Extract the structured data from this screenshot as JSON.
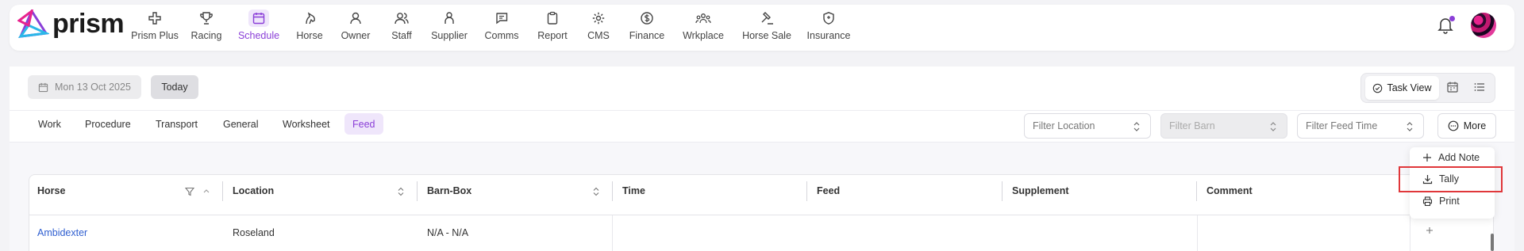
{
  "brand": {
    "name": "prism"
  },
  "nav": {
    "items": [
      {
        "label": "Prism Plus",
        "icon": "hospital-cross-icon"
      },
      {
        "label": "Racing",
        "icon": "trophy-icon"
      },
      {
        "label": "Schedule",
        "icon": "calendar-icon",
        "active": true
      },
      {
        "label": "Horse",
        "icon": "horse-icon"
      },
      {
        "label": "Owner",
        "icon": "user-icon"
      },
      {
        "label": "Staff",
        "icon": "users-icon"
      },
      {
        "label": "Supplier",
        "icon": "person-icon"
      },
      {
        "label": "Comms",
        "icon": "message-icon"
      },
      {
        "label": "Report",
        "icon": "clipboard-icon"
      },
      {
        "label": "CMS",
        "icon": "gear-icon"
      },
      {
        "label": "Finance",
        "icon": "dollar-icon"
      },
      {
        "label": "Wrkplace",
        "icon": "team-icon"
      },
      {
        "label": "Horse Sale",
        "icon": "gavel-icon"
      },
      {
        "label": "Insurance",
        "icon": "shield-icon"
      }
    ]
  },
  "toolbar": {
    "date": "Mon 13 Oct 2025",
    "today_label": "Today",
    "task_view_label": "Task View"
  },
  "tabs": [
    {
      "label": "Work"
    },
    {
      "label": "Procedure"
    },
    {
      "label": "Transport"
    },
    {
      "label": "General"
    },
    {
      "label": "Worksheet"
    },
    {
      "label": "Feed",
      "active": true
    }
  ],
  "filters": {
    "location_placeholder": "Filter Location",
    "barn_placeholder": "Filter Barn",
    "feed_time_placeholder": "Filter Feed Time",
    "more_label": "More"
  },
  "menu": {
    "items": [
      {
        "label": "Add Note",
        "icon": "plus-icon"
      },
      {
        "label": "Tally",
        "icon": "download-icon"
      },
      {
        "label": "Print",
        "icon": "printer-icon"
      }
    ]
  },
  "table": {
    "columns": [
      "Horse",
      "Location",
      "Barn-Box",
      "Time",
      "Feed",
      "Supplement",
      "Comment"
    ],
    "rows": [
      {
        "horse": "Ambidexter",
        "location": "Roseland",
        "barn_box": "N/A - N/A",
        "time": "",
        "feed": "",
        "supplement": "",
        "comment": ""
      }
    ]
  },
  "colors": {
    "accent": "#8b3fd8",
    "accent_bg": "#efe6fb",
    "link": "#2f5fd0",
    "highlight": "#e0373a"
  }
}
